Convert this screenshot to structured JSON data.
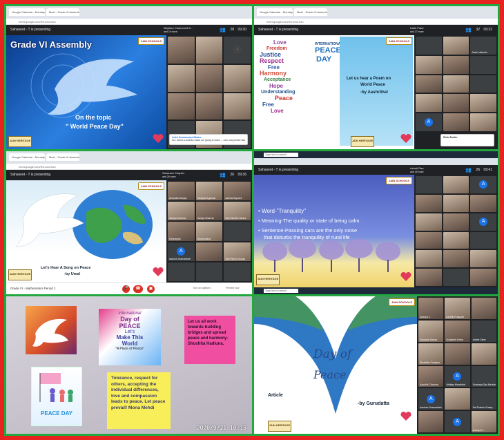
{
  "collage_colors": {
    "outer_border": "#e8221f",
    "inner_border": "#22a83c"
  },
  "browser": {
    "tab1": "Google Calendar - Monday, 21 ...",
    "tab2": "Meet - Grade VI Assembly",
    "url": "meet.google.com/fvh-sevt-hsn"
  },
  "p1": {
    "presenting": "Sahaseet - T is presenting",
    "host": "Mayilsur Chaturvedi K...",
    "host_sub": "and 24 more",
    "count": "28",
    "clock": "09:30",
    "title": "Grade VI Assembly",
    "topic_1": "On the topic",
    "topic_2": "\" World Peace Day\"",
    "badge": "JAIN SCHOOLS",
    "logo": "JAIN HERITAGE",
    "notice_name": "Ankit Hemlaxmiya Mhatre",
    "notice_text": "Do i admit a Ansharu Mark me going to clash ... Join now please take notes"
  },
  "p2": {
    "presenting": "Sahaseet - T is presenting",
    "host": "Kathi Patel",
    "host_sub": "and 27 more",
    "count": "32",
    "clock": "09:32",
    "poster_title_1": "INTERNATIONAL",
    "poster_title_2": "PEACE",
    "poster_title_3": "DAY",
    "words": [
      "Love",
      "Freedom",
      "Justice",
      "Respect",
      "Free",
      "Harmony",
      "Acceptance",
      "Hope",
      "Understanding",
      "Peace",
      "Free",
      "Love"
    ],
    "text_1": "Let us hear a Poem on",
    "text_2": "World Peace",
    "text_3": "-by Aashritha!",
    "badge": "JAIN SCHOOLS",
    "logo": "JAIN HERITAGE",
    "tile_name": "Jaslin Valentin",
    "notice": "Ridhi Parikh"
  },
  "p3": {
    "presenting": "Sahaseet - T is presenting",
    "host": "Sakarsen Chapter",
    "host_sub": "and 26 more",
    "count": "26",
    "clock": "09:36",
    "text_1": "Let's Hear A Song on Peace",
    "text_2": "-by Uma!",
    "badge": "JAIN SCHOOLS",
    "logo": "JAIN HERITAGE",
    "meeting_name": "Grade VI - Mathematics Period 1",
    "present_label": "Turn on captions",
    "present_label2": "Present now",
    "names": [
      "Anushka Sanjay",
      "Sanjana Agarwal",
      "Asmita Sejwani",
      "Saniya Sharma",
      "Saniya Sharma",
      "Sai Paarthi Krishna",
      "Deepanjali",
      "Dhanushkha",
      "Sai Prabhu Gudap",
      "Aamish Jhamaribeb"
    ]
  },
  "p4": {
    "presenting": "Sahaseet - T is presenting",
    "host": "Ashriti Rao",
    "host_sub": "and 25 more",
    "count": "26",
    "clock": "09:41",
    "bullet_1": "Word-\"Tranquility\"",
    "bullet_2": "Meaning-The quality or state of being calm.",
    "bullet_3a": "Sentence-Passing cars are the only noise",
    "bullet_3b": "that disturbs the tranquility of rural life",
    "badge": "JAIN SCHOOLS",
    "logo": "JAIN HERITAGE"
  },
  "p5": {
    "card_dove_label": "",
    "card_day_1": "International",
    "card_day_2": "Day of",
    "card_day_3": "PEACE",
    "card_day_4": "Let's",
    "card_day_5": "Make This",
    "card_day_6": "World",
    "card_day_7": "\"A Place of Peace\"",
    "pink_note": "Let us all work towards building bridges and spread peace and harmony- Shuchita Hadiuna.",
    "yellow_note": "Tolerance, respect for others, accepting the individual differences, love and compassion leads to peace. Let peace prevail! Mona Mehdi",
    "peace_day_card": "PEACE DAY",
    "stamp": "2020/9/21  10:15"
  },
  "p6": {
    "slide_title_1": "Day of",
    "slide_title_2": "Peace",
    "label": "Article",
    "by": "-by Gurudatta",
    "badge": "JAIN SCHOOLS",
    "logo": "JAIN HERITAGE",
    "names": [
      "Ananya C",
      "Karthik Prasanth",
      "Ananya C",
      "Sukanya Sarkar",
      "Shraddha Sanjana",
      "Suhasmit Sinha",
      "Aniket Sane",
      "Kaushik Chandra",
      "Abhijay Manchhel",
      "Surmaya Das Mehnin",
      "Aaviesh Jhamaribeb",
      "Sai Prabhu Gudap"
    ],
    "avatar_letters": [
      "A",
      "A",
      "A"
    ]
  }
}
